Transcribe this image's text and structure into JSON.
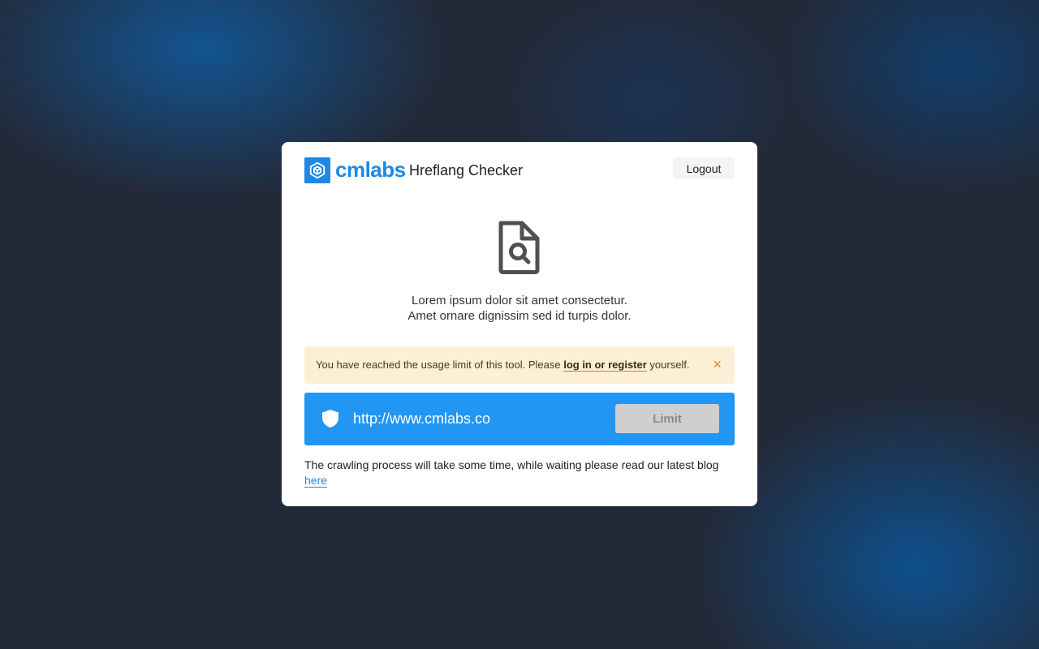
{
  "app": {
    "brand": "cmlabs",
    "tool_title": "Hreflang Checker",
    "logout_label": "Logout"
  },
  "main": {
    "description_line1": "Lorem ipsum dolor sit amet consectetur.",
    "description_line2": "Amet ornare dignissim sed id turpis dolor."
  },
  "alert": {
    "text_before": "You have reached the usage limit of this tool. Please ",
    "link_label": "log in or register",
    "text_after": " yourself.",
    "close_symbol": "×"
  },
  "url_bar": {
    "url_value": "http://www.cmlabs.co",
    "button_label": "Limit"
  },
  "footer": {
    "text": "The crawling process will take some time, while waiting please read our latest blog ",
    "link_label": "here"
  },
  "icons": {
    "logo": "cube-logo-icon",
    "document": "document-search-icon",
    "shield": "shield-icon",
    "close": "close-icon"
  },
  "colors": {
    "brand": "#1e88e5",
    "url_bar": "#2196f3",
    "alert_bg": "#fcefd6",
    "disabled_button": "#cfcfcf"
  }
}
